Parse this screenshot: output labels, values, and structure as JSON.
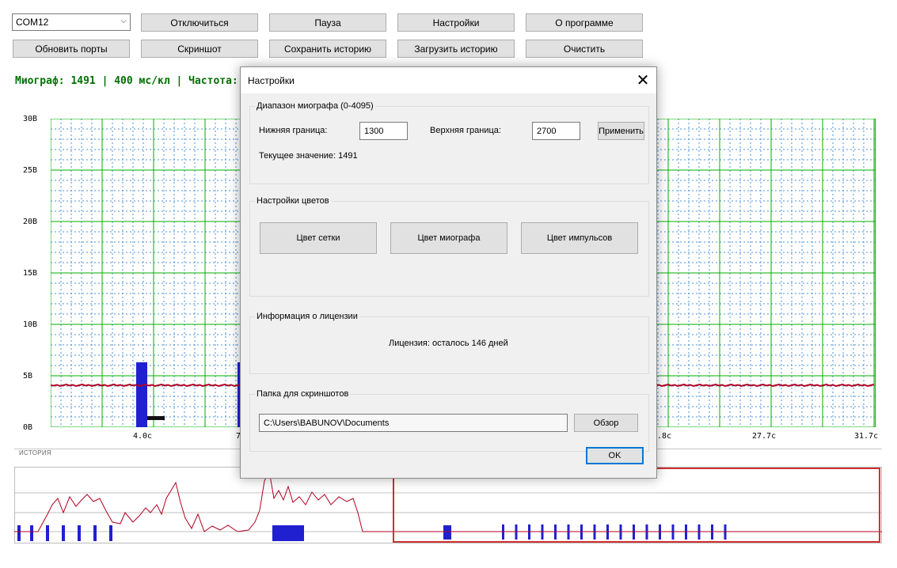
{
  "toolbar": {
    "port": "COM12",
    "disconnect": "Отключиться",
    "pause": "Пауза",
    "settings": "Настройки",
    "about": "О программе",
    "refresh_ports": "Обновить порты",
    "screenshot": "Скриншот",
    "save_history": "Сохранить историю",
    "load_history": "Загрузить историю",
    "clear": "Очистить"
  },
  "status_text": "Миограф: 1491  | 400 мс/кл  | Частота: 1.0Г",
  "chart": {
    "y_labels": [
      "30В",
      "25В",
      "20В",
      "15В",
      "10В",
      "5В",
      "0В"
    ],
    "x_labels": [
      "4.0с",
      "7",
      ".8с",
      "27.7с",
      "31.7с"
    ],
    "colors": {
      "grid": "#00b000",
      "minor_grid": "#4a90d9",
      "signal": "#b00020",
      "pulse": "#2020d0"
    }
  },
  "history": {
    "title": "ИСТОРИЯ"
  },
  "dialog": {
    "title": "Настройки",
    "close_glyph": "✕",
    "range_group": "Диапазон миографа (0-4095)",
    "lower_label": "Нижняя граница:",
    "lower_value": "1300",
    "upper_label": "Верхняя граница:",
    "upper_value": "2700",
    "apply": "Применить",
    "current_value": "Текущее значение: 1491",
    "colors_group": "Настройки цветов",
    "grid_color": "Цвет сетки",
    "myo_color": "Цвет миографа",
    "pulse_color": "Цвет импульсов",
    "license_group": "Информация о лицензии",
    "license_text": "Лицензия: осталось 146 дней",
    "folder_group": "Папка для скриншотов",
    "folder_path": "C:\\Users\\BABUNOV\\Documents",
    "browse": "Обзор",
    "ok": "OK"
  }
}
